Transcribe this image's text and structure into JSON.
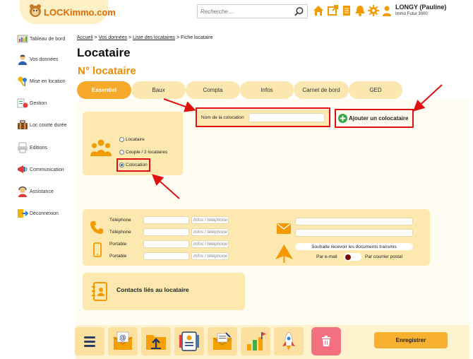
{
  "brand": {
    "logo_text": "LOCKimmo.com"
  },
  "search": {
    "placeholder": "Recherche ..."
  },
  "user": {
    "name": "LONGY (Pauline)",
    "company": "Immo Futur 3000"
  },
  "header_icons": [
    "home-icon",
    "external-link-icon",
    "document-icon",
    "bell-icon",
    "gear-icon",
    "user-icon"
  ],
  "sidebar": {
    "items": [
      {
        "label": "Tableau de bord",
        "icon": "dashboard-icon"
      },
      {
        "label": "Vos données",
        "icon": "person-icon"
      },
      {
        "label": "Mise en location",
        "icon": "keys-icon"
      },
      {
        "label": "Gestion",
        "icon": "management-icon"
      },
      {
        "label": "Loc courte durée",
        "icon": "suitcase-icon"
      },
      {
        "label": "Editions",
        "icon": "print-icon"
      },
      {
        "label": "Communication",
        "icon": "communication-icon"
      },
      {
        "label": "Assistance",
        "icon": "support-icon"
      },
      {
        "label": "Déconnexion",
        "icon": "logout-icon"
      }
    ]
  },
  "breadcrumb": {
    "items": [
      "Accueil",
      "Vos données",
      "Liste des locataires",
      "Fiche locataire"
    ],
    "separator": ">"
  },
  "page": {
    "title": "Locataire",
    "subtitle": "N° locataire"
  },
  "tabs": [
    {
      "label": "Essentiel",
      "active": true
    },
    {
      "label": "Baux",
      "active": false
    },
    {
      "label": "Compta",
      "active": false
    },
    {
      "label": "Infos",
      "active": false
    },
    {
      "label": "Carnet de bord",
      "active": false
    },
    {
      "label": "GED",
      "active": false
    }
  ],
  "tenant_type": {
    "options": [
      "Locataire",
      "Couple / 2 locataires",
      "Colocation"
    ],
    "selected": "Colocation"
  },
  "colocation": {
    "name_label": "Nom de la colocation",
    "name_value": ""
  },
  "add_colocataire": {
    "label": "Ajouter un colocataire"
  },
  "contact": {
    "phones": [
      {
        "label": "Téléphone",
        "value": "",
        "info_placeholder": "Infos / téléphone"
      },
      {
        "label": "Téléphone",
        "value": "",
        "info_placeholder": "Infos / téléphone"
      },
      {
        "label": "Portable",
        "value": "",
        "info_placeholder": "Infos / téléphone"
      },
      {
        "label": "Portable",
        "value": "",
        "info_placeholder": "Infos / téléphone"
      }
    ],
    "emails": [
      "",
      ""
    ],
    "documents_question": "Souhaite recevoir les documents transmis",
    "by_email_label": "Par e-mail",
    "by_post_label": "Par courrier postal"
  },
  "contacts_section": {
    "title": "Contacts liés au locataire"
  },
  "bottom_bar": {
    "icons": [
      "menu-icon",
      "email-icon",
      "folder-upload-icon",
      "id-card-icon",
      "letter-icon",
      "chart-icon",
      "rocket-icon",
      "trash-icon"
    ]
  },
  "save": {
    "label": "Enregistrer"
  },
  "colors": {
    "accent": "#f7a92a",
    "title_orange": "#ef8c00",
    "panel": "#fde9b0",
    "annotation_red": "#e01010"
  }
}
